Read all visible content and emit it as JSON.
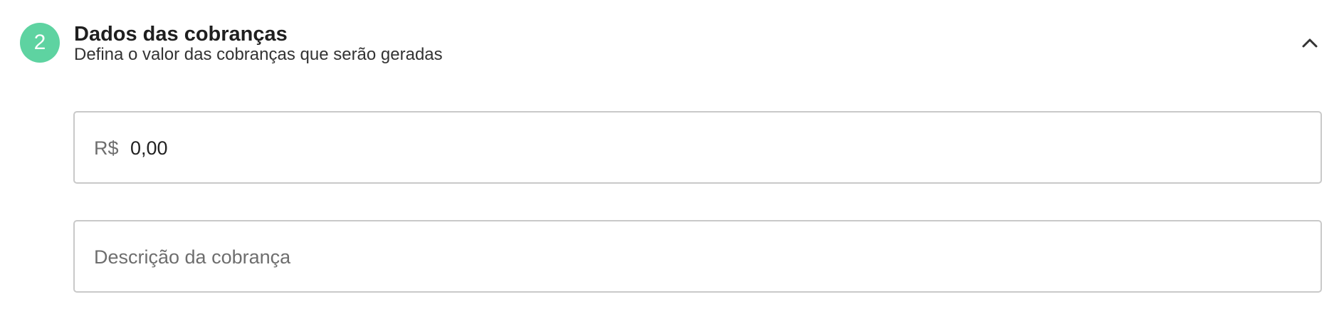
{
  "section": {
    "step_number": "2",
    "title": "Dados das cobranças",
    "subtitle": "Defina o valor das cobranças que serão geradas",
    "accent_color": "#5ed3a1",
    "toggle_icon": "chevron-up-icon",
    "toggle_state": "expanded"
  },
  "form": {
    "amount": {
      "currency_prefix": "R$",
      "value": "0,00"
    },
    "description": {
      "placeholder": "Descrição da cobrança",
      "value": ""
    }
  }
}
